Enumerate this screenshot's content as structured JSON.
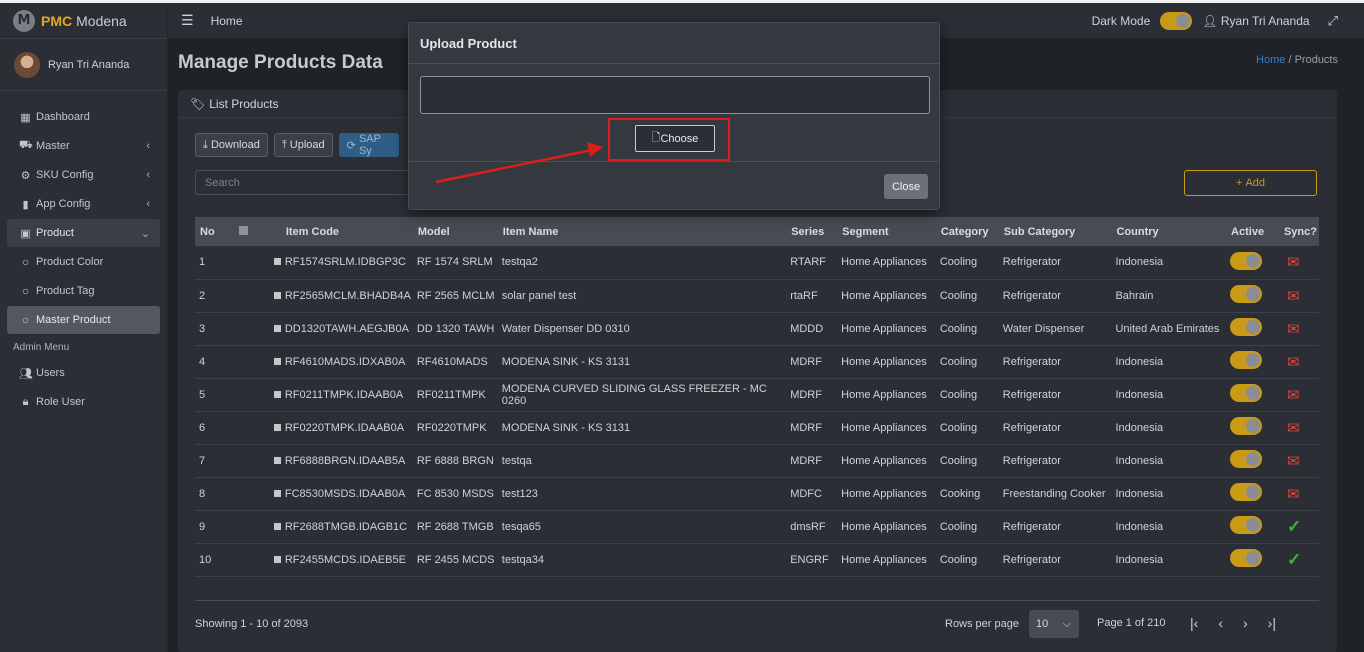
{
  "brand": {
    "logo_letter": "M",
    "pmc": "PMC",
    "name": "Modena"
  },
  "user": {
    "name": "Ryan Tri Ananda"
  },
  "sidebar": {
    "items": [
      {
        "label": "Dashboard",
        "icon": "grid-icon"
      },
      {
        "label": "Master",
        "icon": "car-icon",
        "chevron": "‹"
      },
      {
        "label": "SKU Config",
        "icon": "gear-icon",
        "chevron": "‹"
      },
      {
        "label": "App Config",
        "icon": "mobile-icon",
        "chevron": "‹"
      },
      {
        "label": "Product",
        "icon": "box-icon",
        "chevron": "⌄"
      },
      {
        "label": "Product Color",
        "icon": "circle-icon"
      },
      {
        "label": "Product Tag",
        "icon": "circle-icon"
      },
      {
        "label": "Master Product",
        "icon": "circle-icon"
      }
    ],
    "admin_header": "Admin Menu",
    "admin_items": [
      {
        "label": "Users",
        "icon": "users-icon"
      },
      {
        "label": "Role User",
        "icon": "lock-icon"
      }
    ]
  },
  "topbar": {
    "home": "Home",
    "dark_mode": "Dark Mode",
    "user": "Ryan Tri Ananda"
  },
  "page": {
    "title": "Manage Products Data",
    "crumb_home": "Home",
    "crumb_sep": "/",
    "crumb_current": "Products"
  },
  "card": {
    "title": "List Products"
  },
  "toolbar": {
    "download": "Download",
    "upload": "Upload",
    "sap": "SAP Sy",
    "search_placeholder": "Search",
    "add": "Add"
  },
  "table": {
    "headers": [
      "No",
      "",
      "Item Code",
      "Model",
      "Item Name",
      "Series",
      "Segment",
      "Category",
      "Sub Category",
      "Country",
      "Active",
      "Sync?"
    ],
    "rows": [
      {
        "no": "1",
        "code": "RF1574SRLM.IDBGP3C",
        "model": "RF 1574 SRLM",
        "name": "testqa2",
        "series": "RTARF",
        "segment": "Home Appliances",
        "category": "Cooling",
        "sub": "Refrigerator",
        "country": "Indonesia",
        "synced": false
      },
      {
        "no": "2",
        "code": "RF2565MCLM.BHADB4A",
        "model": "RF 2565 MCLM",
        "name": "solar panel test",
        "series": "rtaRF",
        "segment": "Home Appliances",
        "category": "Cooling",
        "sub": "Refrigerator",
        "country": "Bahrain",
        "synced": false
      },
      {
        "no": "3",
        "code": "DD1320TAWH.AEGJB0A",
        "model": "DD 1320 TAWH",
        "name": "Water Dispenser DD 0310",
        "series": "MDDD",
        "segment": "Home Appliances",
        "category": "Cooling",
        "sub": "Water Dispenser",
        "country": "United Arab Emirates",
        "synced": false
      },
      {
        "no": "4",
        "code": "RF4610MADS.IDXAB0A",
        "model": "RF4610MADS",
        "name": "MODENA SINK - KS 3131",
        "series": "MDRF",
        "segment": "Home Appliances",
        "category": "Cooling",
        "sub": "Refrigerator",
        "country": "Indonesia",
        "synced": false
      },
      {
        "no": "5",
        "code": "RF0211TMPK.IDAAB0A",
        "model": "RF0211TMPK",
        "name": "MODENA CURVED SLIDING GLASS FREEZER - MC 0260",
        "series": "MDRF",
        "segment": "Home Appliances",
        "category": "Cooling",
        "sub": "Refrigerator",
        "country": "Indonesia",
        "synced": false
      },
      {
        "no": "6",
        "code": "RF0220TMPK.IDAAB0A",
        "model": "RF0220TMPK",
        "name": "MODENA SINK - KS 3131",
        "series": "MDRF",
        "segment": "Home Appliances",
        "category": "Cooling",
        "sub": "Refrigerator",
        "country": "Indonesia",
        "synced": false
      },
      {
        "no": "7",
        "code": "RF6888BRGN.IDAAB5A",
        "model": "RF 6888 BRGN",
        "name": "testqa",
        "series": "MDRF",
        "segment": "Home Appliances",
        "category": "Cooling",
        "sub": "Refrigerator",
        "country": "Indonesia",
        "synced": false
      },
      {
        "no": "8",
        "code": "FC8530MSDS.IDAAB0A",
        "model": "FC 8530 MSDS",
        "name": "test123",
        "series": "MDFC",
        "segment": "Home Appliances",
        "category": "Cooking",
        "sub": "Freestanding Cooker",
        "country": "Indonesia",
        "synced": false
      },
      {
        "no": "9",
        "code": "RF2688TMGB.IDAGB1C",
        "model": "RF 2688 TMGB",
        "name": "tesqa65",
        "series": "dmsRF",
        "segment": "Home Appliances",
        "category": "Cooling",
        "sub": "Refrigerator",
        "country": "Indonesia",
        "synced": true
      },
      {
        "no": "10",
        "code": "RF2455MCDS.IDAEB5E",
        "model": "RF 2455 MCDS",
        "name": "testqa34",
        "series": "ENGRF",
        "segment": "Home Appliances",
        "category": "Cooling",
        "sub": "Refrigerator",
        "country": "Indonesia",
        "synced": true
      }
    ]
  },
  "footer": {
    "showing": "Showing 1 - 10 of 2093",
    "rows_per_page": "Rows per page",
    "rows_value": "10",
    "page_info": "Page 1 of 210"
  },
  "modal": {
    "title": "Upload Product",
    "choose": "Choose",
    "close": "Close"
  },
  "colors": {
    "accent": "#c99a16",
    "annotation": "#e01b1b",
    "sync_ok": "#3fb23a",
    "sync_pending": "#d9463f"
  }
}
